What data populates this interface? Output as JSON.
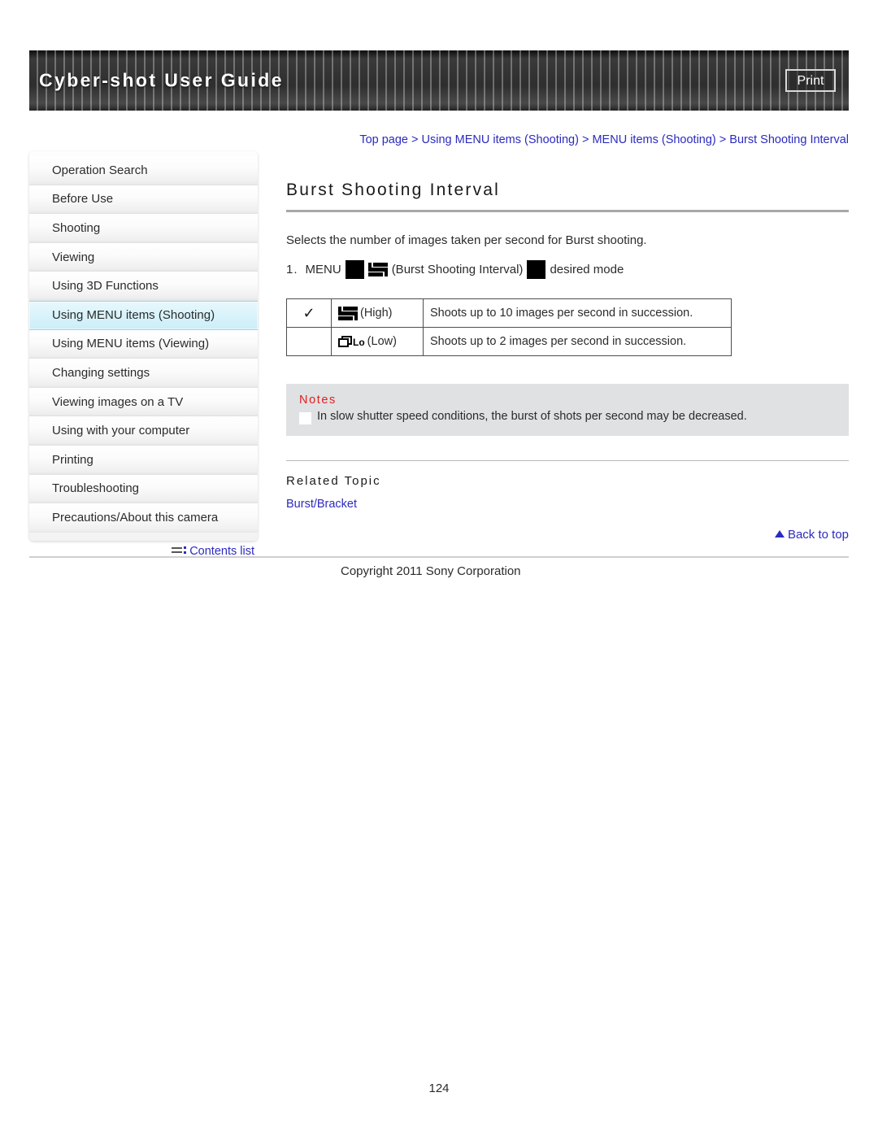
{
  "header": {
    "title": "Cyber-shot User Guide",
    "print_label": "Print"
  },
  "breadcrumb": {
    "separator": " > ",
    "items": [
      "Top page",
      "Using MENU items (Shooting)",
      "MENU items (Shooting)",
      "Burst Shooting Interval"
    ]
  },
  "sidebar": {
    "items": [
      {
        "label": "Operation Search",
        "active": false
      },
      {
        "label": "Before Use",
        "active": false
      },
      {
        "label": "Shooting",
        "active": false
      },
      {
        "label": "Viewing",
        "active": false
      },
      {
        "label": "Using 3D Functions",
        "active": false
      },
      {
        "label": "Using MENU items (Shooting)",
        "active": true
      },
      {
        "label": "Using MENU items (Viewing)",
        "active": false
      },
      {
        "label": "Changing settings",
        "active": false
      },
      {
        "label": "Viewing images on a TV",
        "active": false
      },
      {
        "label": "Using with your computer",
        "active": false
      },
      {
        "label": "Printing",
        "active": false
      },
      {
        "label": "Troubleshooting",
        "active": false
      },
      {
        "label": "Precautions/About this camera",
        "active": false
      }
    ],
    "contents_list_label": "Contents list"
  },
  "main": {
    "title": "Burst Shooting Interval",
    "intro": "Selects the number of images taken per second for Burst shooting.",
    "step": {
      "number": "1.",
      "menu_label": "MENU",
      "icon_label": "(Burst Shooting Interval)",
      "tail_label": "desired mode"
    },
    "table": {
      "rows": [
        {
          "checked": "✓",
          "mode": "(High)",
          "icon": "burst-high-icon",
          "description": "Shoots up to 10 images per second in succession."
        },
        {
          "checked": "",
          "mode": "(Low)",
          "icon": "burst-low-icon",
          "lo_text": "Lo",
          "description": "Shoots up to 2 images per second in succession."
        }
      ]
    },
    "notes": {
      "title": "Notes",
      "items": [
        "In slow shutter speed conditions, the burst of shots per second may be decreased."
      ]
    },
    "related": {
      "title": "Related Topic",
      "links": [
        "Burst/Bracket"
      ]
    },
    "back_to_top_label": "Back to top"
  },
  "footer": {
    "copyright": "Copyright 2011 Sony Corporation",
    "page_number": "124"
  },
  "colors": {
    "link": "#2b2bc0",
    "notes_title": "#e02020",
    "notes_bg": "#dfe1e3",
    "active_nav": "#d6f2fa",
    "header_bg": "#2e2e2e"
  }
}
